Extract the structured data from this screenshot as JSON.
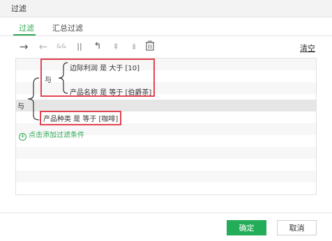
{
  "dialog": {
    "title": "过滤"
  },
  "tabs": [
    {
      "label": "过滤",
      "active": true
    },
    {
      "label": "汇总过滤",
      "active": false
    }
  ],
  "toolbar": {
    "tools": [
      {
        "icon": "arrow-right-icon",
        "glyph": "→",
        "enabled": true
      },
      {
        "icon": "arrow-left-icon",
        "glyph": "←",
        "enabled": false
      },
      {
        "icon": "and-icon",
        "glyph": "&&",
        "enabled": false
      },
      {
        "icon": "or-icon",
        "glyph": "||",
        "enabled": false
      },
      {
        "icon": "corner-arrow-icon",
        "glyph": "↰",
        "enabled": true
      },
      {
        "icon": "move-up-icon",
        "glyph": "⇞",
        "enabled": false
      },
      {
        "icon": "move-down-icon",
        "glyph": "⇟",
        "enabled": false
      },
      {
        "icon": "delete-icon",
        "glyph": "🗑",
        "enabled": true
      }
    ],
    "clear_label": "清空"
  },
  "conditions": {
    "outer_logic": "与",
    "inner_logic": "与",
    "cond1": "边际利润 是 大于 [10]",
    "cond2": "产品名称 是 等于 [伯爵茶]",
    "cond3": "产品种类 是 等于 [咖啡]"
  },
  "add_condition_label": "点击添加过滤条件",
  "footer": {
    "ok_label": "确定",
    "cancel_label": "取消"
  },
  "colors": {
    "accent": "#2eaa55",
    "highlight": "#e2424f"
  }
}
